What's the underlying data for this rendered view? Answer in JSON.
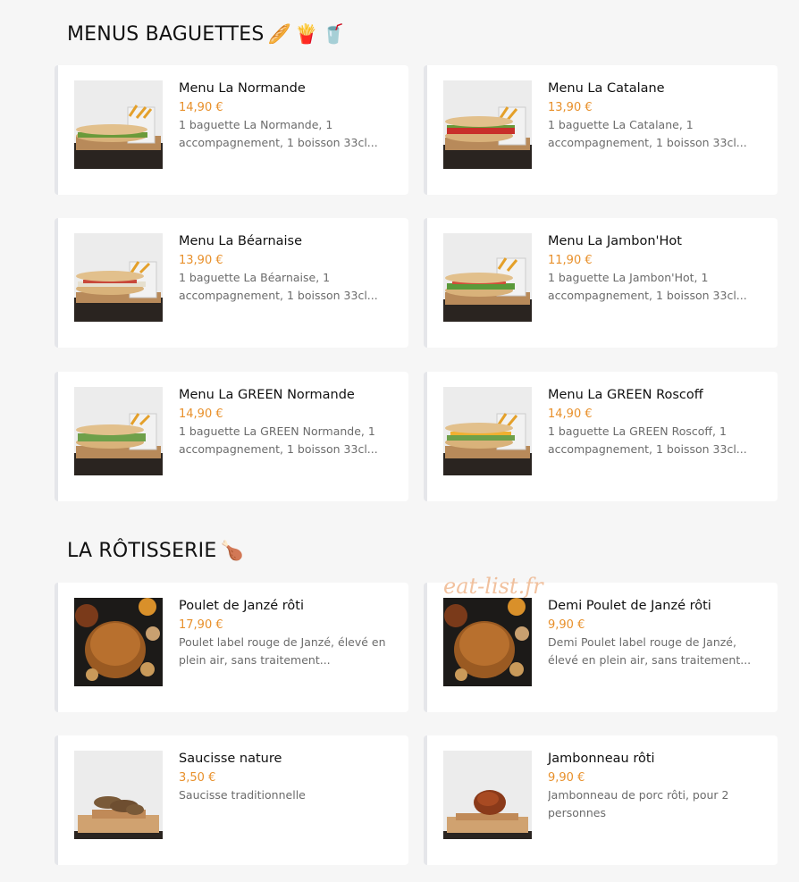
{
  "sections": [
    {
      "title": "MENUS BAGUETTES",
      "emojis": [
        "🥖",
        "🍟",
        "🥤"
      ],
      "items": [
        {
          "name": "Menu La Normande",
          "price": "14,90 €",
          "desc": "1 baguette La Normande, 1 accompagnement, 1 boisson 33cl..."
        },
        {
          "name": "Menu La Catalane",
          "price": "13,90 €",
          "desc": "1 baguette La Catalane, 1 accompagnement, 1 boisson 33cl..."
        },
        {
          "name": "Menu La Béarnaise",
          "price": "13,90 €",
          "desc": "1 baguette La Béarnaise, 1 accompagnement, 1 boisson 33cl..."
        },
        {
          "name": "Menu La Jambon'Hot",
          "price": "11,90 €",
          "desc": "1 baguette La Jambon'Hot, 1 accompagnement, 1 boisson 33cl..."
        },
        {
          "name": "Menu La GREEN Normande",
          "price": "14,90 €",
          "desc": "1 baguette La GREEN Normande, 1 accompagnement, 1 boisson 33cl..."
        },
        {
          "name": "Menu La GREEN Roscoff",
          "price": "14,90 €",
          "desc": "1 baguette La GREEN Roscoff, 1 accompagnement, 1 boisson 33cl..."
        }
      ]
    },
    {
      "title": "LA RÔTISSERIE",
      "emojis": [
        "🍗"
      ],
      "items": [
        {
          "name": "Poulet de Janzé rôti",
          "price": "17,90 €",
          "desc": "Poulet label rouge de Janzé, élevé en plein air, sans traitement..."
        },
        {
          "name": "Demi Poulet de Janzé rôti",
          "price": "9,90 €",
          "desc": "Demi Poulet label rouge de Janzé, élevé en plein air, sans traitement..."
        },
        {
          "name": "Saucisse nature",
          "price": "3,50 €",
          "desc": "Saucisse traditionnelle"
        },
        {
          "name": "Jambonneau rôti",
          "price": "9,90 €",
          "desc": "Jambonneau de porc rôti, pour 2 personnes"
        }
      ]
    }
  ],
  "watermark": "eat-list.fr",
  "colors": {
    "price": "#e8902b",
    "background": "#f6f6f6",
    "card": "#ffffff",
    "card_border": "#e5e6ea"
  }
}
